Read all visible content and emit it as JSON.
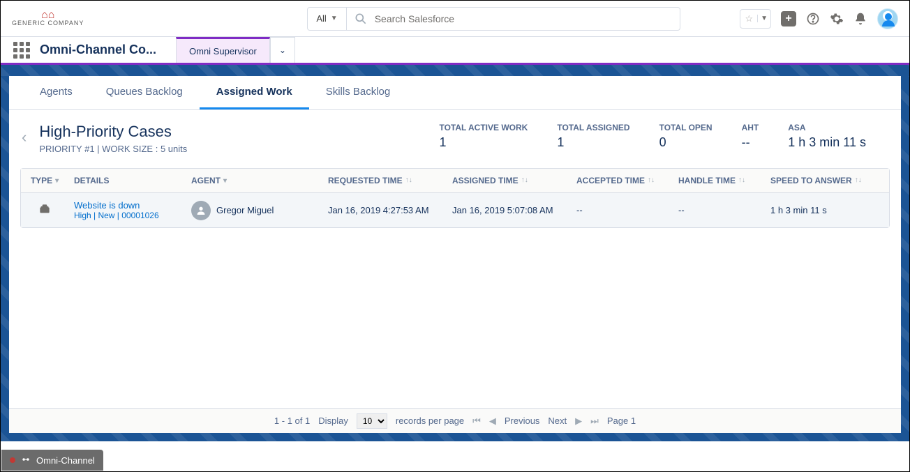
{
  "header": {
    "logo_text": "GENERIC COMPANY",
    "search_scope": "All",
    "search_placeholder": "Search Salesforce"
  },
  "appbar": {
    "app_title": "Omni-Channel Co...",
    "active_tab": "Omni Supervisor"
  },
  "subtabs": {
    "agents": "Agents",
    "queues": "Queues Backlog",
    "assigned": "Assigned Work",
    "skills": "Skills Backlog"
  },
  "queue": {
    "title": "High-Priority Cases",
    "subtitle": "PRIORITY #1  |  WORK SIZE : 5 units"
  },
  "stats": {
    "active_label": "TOTAL ACTIVE WORK",
    "active_value": "1",
    "assigned_label": "TOTAL ASSIGNED",
    "assigned_value": "1",
    "open_label": "TOTAL OPEN",
    "open_value": "0",
    "aht_label": "AHT",
    "aht_value": "--",
    "asa_label": "ASA",
    "asa_value": "1 h 3 min 11 s"
  },
  "table": {
    "headers": {
      "type": "TYPE",
      "details": "DETAILS",
      "agent": "AGENT",
      "requested": "REQUESTED TIME",
      "assigned": "ASSIGNED TIME",
      "accepted": "ACCEPTED TIME",
      "handle": "HANDLE TIME",
      "speed": "SPEED TO ANSWER"
    },
    "rows": [
      {
        "details_title": "Website is down",
        "details_sub": "High | New | 00001026",
        "agent": "Gregor Miguel",
        "requested": "Jan 16, 2019 4:27:53 AM",
        "assigned": "Jan 16, 2019 5:07:08 AM",
        "accepted": "--",
        "handle": "--",
        "speed": "1 h 3 min 11 s"
      }
    ]
  },
  "pagination": {
    "range": "1 - 1 of 1",
    "display_label": "Display",
    "page_size": "10",
    "rpp_label": "records per page",
    "previous": "Previous",
    "next": "Next",
    "page": "Page 1"
  },
  "utility": {
    "label": "Omni-Channel"
  }
}
